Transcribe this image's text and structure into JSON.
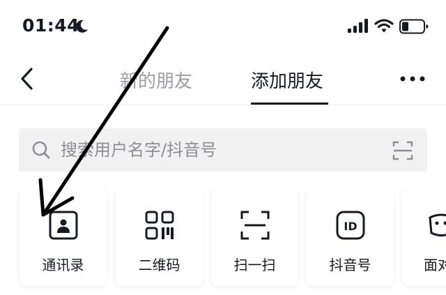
{
  "status": {
    "time": "01:44",
    "icons": [
      "moon-icon",
      "cellular-signal-icon",
      "wifi-icon",
      "battery-icon"
    ]
  },
  "nav": {
    "back_icon": "chevron-left-icon",
    "tabs": [
      {
        "label": "新的朋友",
        "active": false
      },
      {
        "label": "添加朋友",
        "active": true
      }
    ],
    "more_icon": "more-dots-icon"
  },
  "search": {
    "placeholder": "搜索用户名字/抖音号",
    "icon": "search-icon",
    "scan_icon": "scan-icon"
  },
  "actions": [
    {
      "label": "通讯录",
      "icon": "contacts-icon"
    },
    {
      "label": "二维码",
      "icon": "qr-code-icon"
    },
    {
      "label": "扫一扫",
      "icon": "scan-icon"
    },
    {
      "label": "抖音号",
      "icon": "id-icon"
    },
    {
      "label": "面对面",
      "icon": "face-to-face-icon"
    }
  ],
  "colors": {
    "text": "#161823",
    "muted": "#9b9ca2",
    "search_bg": "#f1f1f2",
    "arrow": "#000000"
  }
}
